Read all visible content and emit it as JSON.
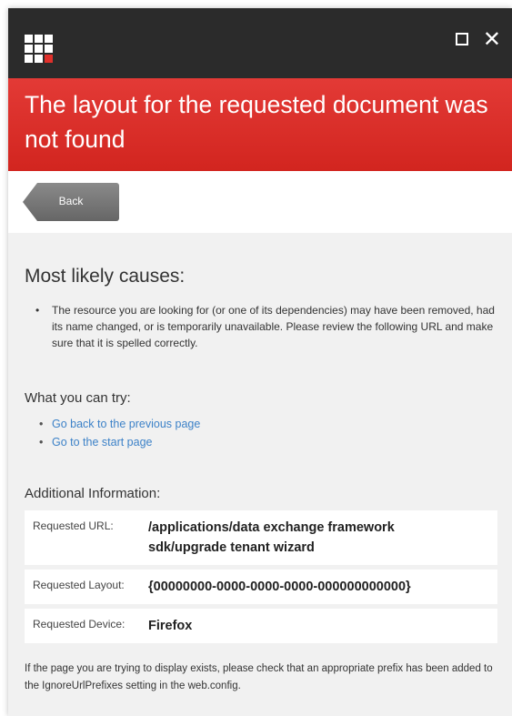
{
  "window": {
    "logo_icon": "grid-logo-icon",
    "maximize_icon": "maximize-icon",
    "close_icon": "close-icon",
    "close_glyph": "✕"
  },
  "banner": {
    "title": "The layout for the requested document was not found"
  },
  "back_button": {
    "label": "Back"
  },
  "causes": {
    "heading": "Most likely causes:",
    "items": [
      "The resource you are looking for (or one of its dependencies) may have been removed, had its name changed, or is temporarily unavailable. Please review the following URL and make sure that it is spelled correctly."
    ]
  },
  "try": {
    "heading": "What you can try:",
    "links": [
      "Go back to the previous page",
      "Go to the start page"
    ]
  },
  "additional": {
    "heading": "Additional Information:",
    "rows": [
      {
        "key": "Requested URL:",
        "value": "/applications/data exchange framework sdk/upgrade tenant wizard"
      },
      {
        "key": "Requested Layout:",
        "value": "{00000000-0000-0000-0000-000000000000}"
      },
      {
        "key": "Requested Device:",
        "value": "Firefox"
      }
    ]
  },
  "footer": "If the page you are trying to display exists, please check that an appropriate prefix has been added to the IgnoreUrlPrefixes setting in the web.config.",
  "colors": {
    "banner": "#d9302b",
    "titlebar": "#2b2b2b",
    "link": "#3d82c8",
    "back_button": "#777777"
  }
}
